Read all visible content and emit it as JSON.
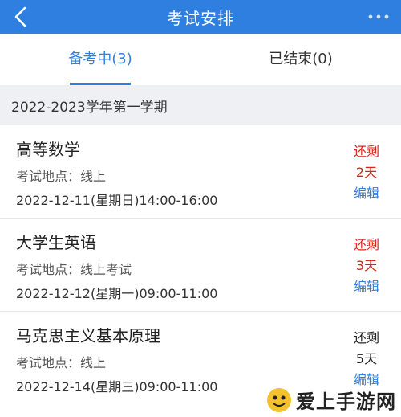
{
  "header": {
    "title": "考试安排",
    "back_icon": "chevron-left-icon",
    "more_icon": "more-dots-icon"
  },
  "tabs": [
    {
      "label": "备考中(3)",
      "active": true
    },
    {
      "label": "已结束(0)",
      "active": false
    }
  ],
  "semester": {
    "label": "2022-2023学年第一学期"
  },
  "exams": [
    {
      "name": "高等数学",
      "place": "考试地点：线上",
      "time": "2022-12-11(星期日)14:00-16:00",
      "remain_label": "还剩",
      "remain_days": "2天",
      "edit_label": "编辑",
      "remain_color": "#d9261c"
    },
    {
      "name": "大学生英语",
      "place": "考试地点：线上考试",
      "time": "2022-12-12(星期一)09:00-11:00",
      "remain_label": "还剩",
      "remain_days": "3天",
      "edit_label": "编辑",
      "remain_color": "#d9261c"
    },
    {
      "name": "马克思主义基本原理",
      "place": "考试地点：线上",
      "time": "2022-12-14(星期三)09:00-11:00",
      "remain_label": "还剩",
      "remain_days": "5天",
      "edit_label": "编辑",
      "remain_color": "#222222"
    }
  ],
  "watermark": {
    "text": "爱上手游网"
  },
  "colors": {
    "accent": "#2f7fe0",
    "urgent": "#d9261c",
    "semester_bg": "#eef0f4"
  }
}
